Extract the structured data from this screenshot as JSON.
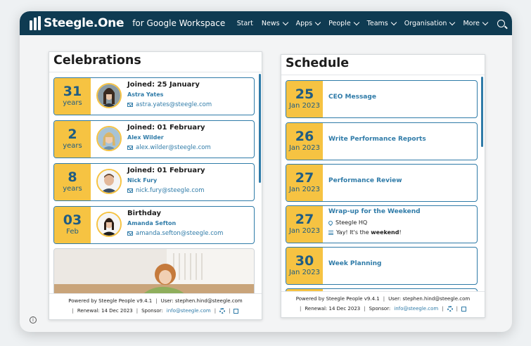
{
  "header": {
    "logo_text": "Steegle.One",
    "logo_sub": "for Google Workspace",
    "nav": [
      {
        "label": "Start",
        "dropdown": false
      },
      {
        "label": "News",
        "dropdown": true
      },
      {
        "label": "Apps",
        "dropdown": true
      },
      {
        "label": "People",
        "dropdown": true
      },
      {
        "label": "Teams",
        "dropdown": true
      },
      {
        "label": "Organisation",
        "dropdown": true
      },
      {
        "label": "More",
        "dropdown": true
      }
    ]
  },
  "celebrations": {
    "title": "Celebrations",
    "items": [
      {
        "num": "31",
        "unit": "years",
        "title": "Joined: 25 January",
        "name": "Astra Yates",
        "email": "astra.yates@steegle.com",
        "avatar": "astra"
      },
      {
        "num": "2",
        "unit": "years",
        "title": "Joined: 01 February",
        "name": "Alex Wilder",
        "email": "alex.wilder@steegle.com",
        "avatar": "alex"
      },
      {
        "num": "8",
        "unit": "years",
        "title": "Joined: 01 February",
        "name": "Nick Fury",
        "email": "nick.fury@steegle.com",
        "avatar": "nick"
      },
      {
        "num": "03",
        "unit": "Feb",
        "title": "Birthday",
        "name": "Amanda Sefton",
        "email": "amanda.sefton@steegle.com",
        "avatar": "amanda"
      }
    ],
    "footer": {
      "powered": "Powered by Steegle People v9.4.1",
      "user": "User: stephen.hind@steegle.com",
      "renewal": "Renewal: 14 Dec 2023",
      "sponsor_label": "Sponsor:",
      "sponsor_email": "info@steegle.com"
    }
  },
  "schedule": {
    "title": "Schedule",
    "items": [
      {
        "day": "25",
        "month": "Jan 2023",
        "title": "CEO Message"
      },
      {
        "day": "26",
        "month": "Jan 2023",
        "title": "Write Performance Reports"
      },
      {
        "day": "27",
        "month": "Jan 2023",
        "title": "Performance Review"
      },
      {
        "day": "27",
        "month": "Jan 2023",
        "title": "Wrap-up for the Weekend",
        "location": "Steegle HQ",
        "note_prefix": "Yay! It's the ",
        "note_bold": "weekend",
        "note_suffix": "!"
      },
      {
        "day": "30",
        "month": "Jan 2023",
        "title": "Week Planning"
      }
    ],
    "footer": {
      "powered": "Powered by Steegle People v9.4.1",
      "user": "User: stephen.hind@steegle.com",
      "renewal": "Renewal: 14 Dec 2023",
      "sponsor_label": "Sponsor:",
      "sponsor_email": "info@steegle.com"
    }
  },
  "colors": {
    "header_bg": "#0f3b52",
    "accent": "#2f7ba8",
    "badge": "#f6c342"
  }
}
